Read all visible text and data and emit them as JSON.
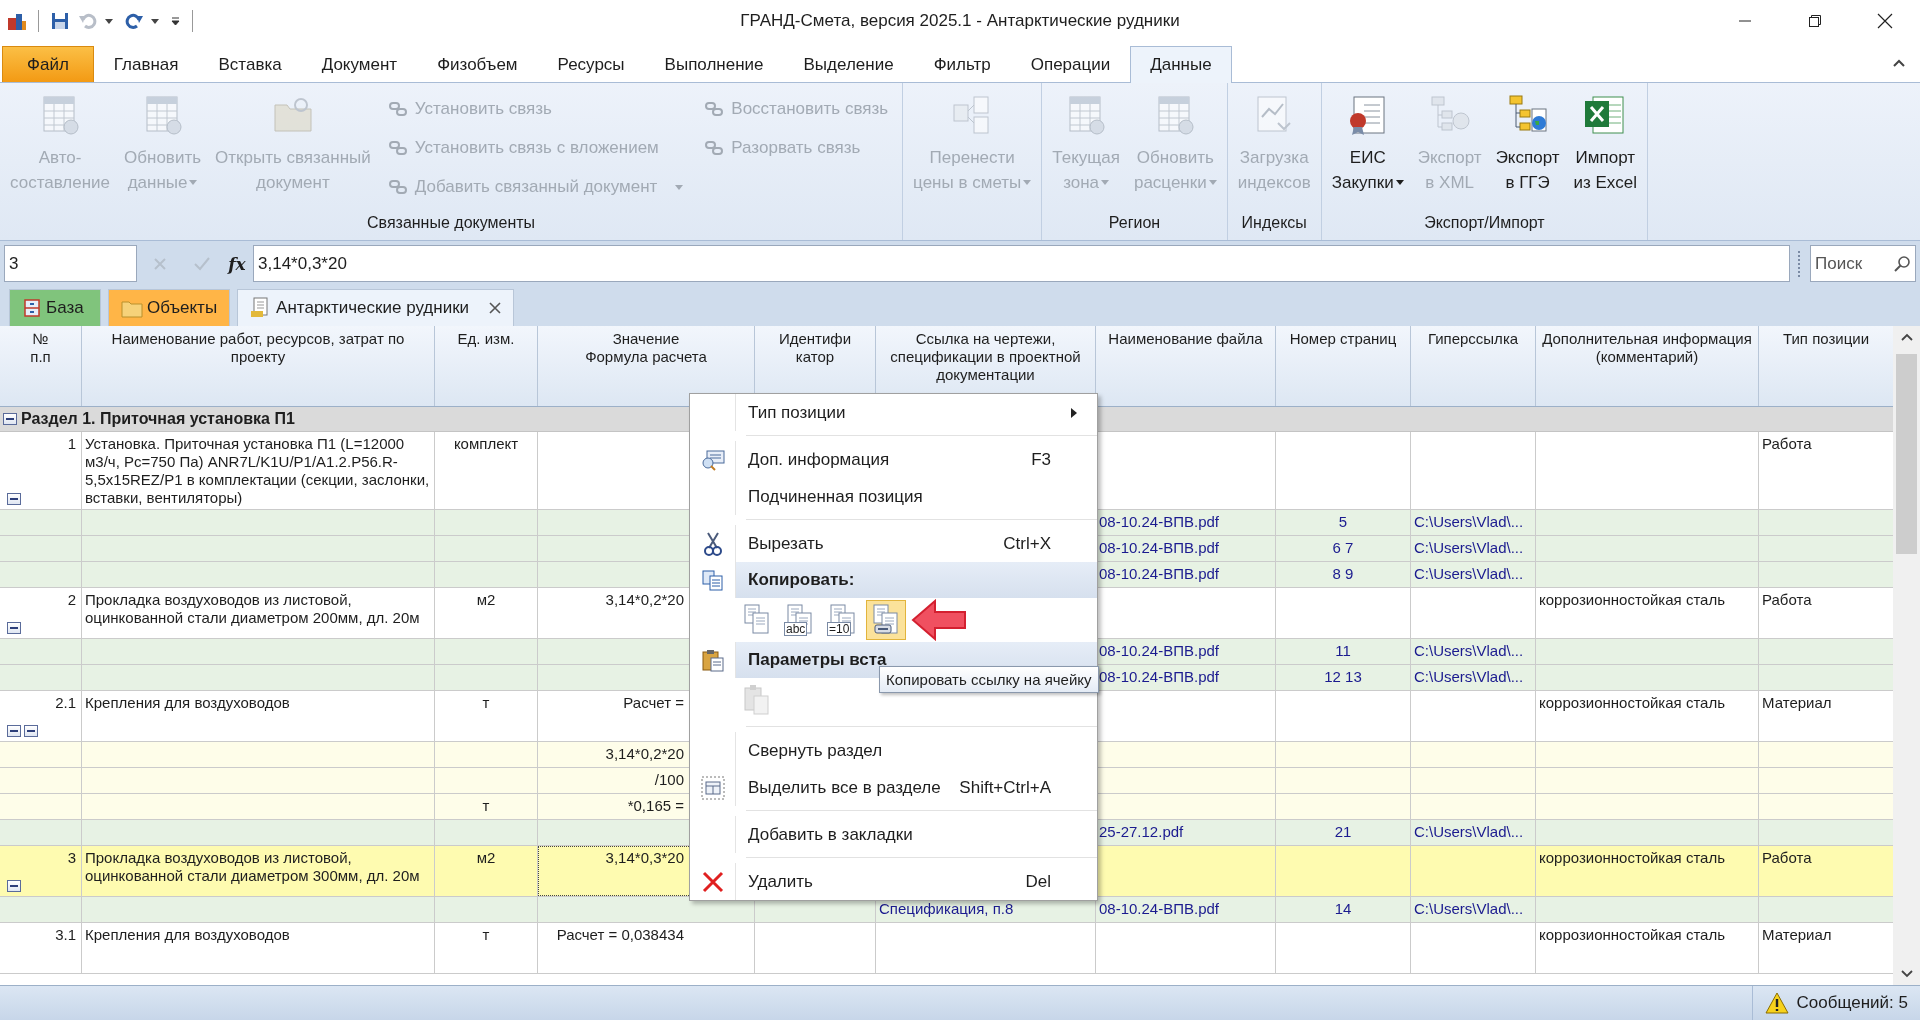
{
  "window": {
    "title": "ГРАНД-Смета, версия 2025.1 - Антарктические рудники"
  },
  "quick_access": [
    {
      "kind": "save",
      "disabled": false,
      "has_menu": false
    },
    {
      "kind": "undo",
      "disabled": true,
      "has_menu": true
    },
    {
      "kind": "redo",
      "disabled": false,
      "has_menu": true
    }
  ],
  "ribbon": {
    "tabs": [
      {
        "label": "Файл",
        "kind": "file",
        "selected": false
      },
      {
        "label": "Главная",
        "kind": "tab",
        "selected": false
      },
      {
        "label": "Вставка",
        "kind": "tab",
        "selected": false
      },
      {
        "label": "Документ",
        "kind": "tab",
        "selected": false
      },
      {
        "label": "Физобъем",
        "kind": "tab",
        "selected": false
      },
      {
        "label": "Ресурсы",
        "kind": "tab",
        "selected": false
      },
      {
        "label": "Выполнение",
        "kind": "tab",
        "selected": false
      },
      {
        "label": "Выделение",
        "kind": "tab",
        "selected": false
      },
      {
        "label": "Фильтр",
        "kind": "tab",
        "selected": false
      },
      {
        "label": "Операции",
        "kind": "tab",
        "selected": false
      },
      {
        "label": "Данные",
        "kind": "tab",
        "selected": true
      }
    ],
    "groups": [
      {
        "label": "Связанные документы",
        "large": [
          {
            "lines": [
              "Авто-",
              "составление"
            ],
            "disabled": true,
            "dropdown": false
          },
          {
            "lines": [
              "Обновить",
              "данные"
            ],
            "disabled": true,
            "dropdown": true
          },
          {
            "lines": [
              "Открыть связанный",
              "документ"
            ],
            "disabled": true,
            "dropdown": false
          }
        ],
        "small_columns": [
          [
            {
              "label": "Установить связь",
              "disabled": true,
              "dropdown": false
            },
            {
              "label": "Установить связь с вложением",
              "disabled": true,
              "dropdown": false
            },
            {
              "label": "Добавить связанный документ",
              "disabled": true,
              "dropdown": true
            }
          ],
          [
            {
              "label": "Восстановить связь",
              "disabled": true,
              "dropdown": false
            },
            {
              "label": "Разорвать связь",
              "disabled": true,
              "dropdown": false
            }
          ]
        ]
      },
      {
        "large": [
          {
            "lines": [
              "Перенести",
              "цены в сметы"
            ],
            "disabled": true,
            "dropdown": true
          }
        ]
      },
      {
        "label": "Регион",
        "large": [
          {
            "lines": [
              "Текущая",
              "зона"
            ],
            "disabled": true,
            "dropdown": true
          },
          {
            "lines": [
              "Обновить",
              "расценки"
            ],
            "disabled": true,
            "dropdown": true
          }
        ]
      },
      {
        "label": "Индексы",
        "large": [
          {
            "lines": [
              "Загрузка",
              "индексов"
            ],
            "disabled": true,
            "dropdown": false
          }
        ]
      },
      {
        "label": "Экспорт/Импорт",
        "large": [
          {
            "lines": [
              "ЕИС",
              "Закупки"
            ],
            "disabled": false,
            "dropdown": true
          },
          {
            "lines": [
              "Экспорт",
              "в XML"
            ],
            "disabled": true,
            "dropdown": false
          },
          {
            "lines": [
              "Экспорт",
              "в ГГЭ"
            ],
            "disabled": false,
            "dropdown": false
          },
          {
            "lines": [
              "Импорт",
              "из Excel"
            ],
            "disabled": false,
            "dropdown": false
          }
        ]
      }
    ]
  },
  "formula_bar": {
    "cell": "3",
    "edit_buttons_disabled": true,
    "function_label": "fx",
    "formula": "3,14*0,3*20",
    "search": {
      "placeholder": "Поиск"
    }
  },
  "doc_tabs": [
    {
      "label": "База",
      "color": "#80c47c",
      "selected": false,
      "closable": false
    },
    {
      "label": "Объекты",
      "color": "#ffb547",
      "selected": false,
      "closable": false
    },
    {
      "label": "Антарктические рудники",
      "selected": true,
      "closable": true
    }
  ],
  "table": {
    "columns": [
      "№\nп.п",
      "Наименование работ, ресурсов, затрат по проекту",
      "Ед. изм.",
      "Значение\nФормула расчета",
      "Идентифи\nкатор",
      "Ссылка на чертежи, спецификации в проектной документации",
      "Наименование файла",
      "Номер страниц",
      "Гиперссылка",
      "Дополнительная информация (комментарий)",
      "Тип позиции"
    ],
    "rows": [
      {
        "kind": "section",
        "title": "Раздел 1. Приточная установка П1",
        "expanded": true
      },
      {
        "kind": "position",
        "selected": false,
        "toggles": [
          {
            "expanded": true
          }
        ],
        "cells": [
          "1",
          "Установка. Приточная установка П1 (L=12000 м3/ч, Рс=750 Па) ANR7L/K1U/P1/A1.2.P56.R-5,5x15REZ/P1 в комплектации (секции, заслонки, вставки, вентиляторы)",
          "комплект",
          null,
          null,
          null,
          null,
          null,
          null,
          null,
          "Работа"
        ]
      },
      {
        "kind": "link",
        "cells": [
          null,
          null,
          null,
          null,
          null,
          null,
          "08-10.24-ВПВ.pdf",
          "5",
          "C:\\Users\\Vlad\\...",
          null,
          null
        ]
      },
      {
        "kind": "link",
        "cells": [
          null,
          null,
          null,
          null,
          null,
          null,
          "08-10.24-ВПВ.pdf",
          "6 7",
          "C:\\Users\\Vlad\\...",
          null,
          null
        ]
      },
      {
        "kind": "link",
        "cells": [
          null,
          null,
          null,
          null,
          null,
          null,
          "08-10.24-ВПВ.pdf",
          "8 9",
          "C:\\Users\\Vlad\\...",
          null,
          null
        ]
      },
      {
        "kind": "position",
        "selected": false,
        "toggles": [
          {
            "expanded": true
          }
        ],
        "cells": [
          "2",
          "Прокладка воздуховодов из листовой, оцинкованной стали диаметром 200мм, дл. 20м",
          "м2",
          "3,14*0,2*20",
          null,
          null,
          null,
          null,
          null,
          "коррозионностойкая сталь",
          "Работа"
        ]
      },
      {
        "kind": "link",
        "cells": [
          null,
          null,
          null,
          null,
          null,
          null,
          "08-10.24-ВПВ.pdf",
          "11",
          "C:\\Users\\Vlad\\...",
          null,
          null
        ]
      },
      {
        "kind": "link",
        "cells": [
          null,
          null,
          null,
          null,
          null,
          null,
          "08-10.24-ВПВ.pdf",
          "12 13",
          "C:\\Users\\Vlad\\...",
          null,
          null
        ]
      },
      {
        "kind": "position",
        "selected": false,
        "toggles": [
          {
            "expanded": true
          },
          {
            "expanded": true
          }
        ],
        "cells": [
          "2.1",
          "Крепления для воздуховодов",
          "т",
          "Расчет =",
          null,
          null,
          null,
          null,
          null,
          "коррозионностойкая сталь",
          "Материал"
        ]
      },
      {
        "kind": "calc",
        "cells": [
          null,
          null,
          null,
          "3,14*0,2*20",
          null,
          null,
          null,
          null,
          null,
          null,
          null
        ]
      },
      {
        "kind": "calc",
        "cells": [
          null,
          null,
          null,
          "/100",
          null,
          null,
          null,
          null,
          null,
          null,
          null
        ]
      },
      {
        "kind": "calc",
        "cells": [
          null,
          null,
          "т",
          "*0,165 =",
          null,
          null,
          null,
          null,
          null,
          null,
          null
        ]
      },
      {
        "kind": "link",
        "cells": [
          null,
          null,
          null,
          null,
          null,
          null,
          "25-27.12.pdf",
          "21",
          "C:\\Users\\Vlad\\...",
          null,
          null
        ]
      },
      {
        "kind": "position",
        "selected": true,
        "toggles": [
          {
            "expanded": true
          }
        ],
        "cells": [
          "3",
          "Прокладка воздуховодов из листовой, оцинкованной стали диаметром 300мм, дл. 20м",
          "м2",
          "3,14*0,3*20",
          null,
          null,
          null,
          null,
          null,
          "коррозионностойкая сталь",
          "Работа"
        ]
      },
      {
        "kind": "link",
        "cells": [
          null,
          null,
          null,
          null,
          null,
          "Спецификация, п.8",
          "08-10.24-ВПВ.pdf",
          "14",
          "C:\\Users\\Vlad\\...",
          null,
          null
        ]
      },
      {
        "kind": "position",
        "selected": false,
        "cells": [
          "3.1",
          "Крепления для воздуховодов",
          "т",
          "Расчет = 0,038434",
          null,
          null,
          null,
          null,
          null,
          "коррозионностойкая сталь",
          "Материал"
        ]
      }
    ]
  },
  "context_menu": {
    "items": [
      {
        "kind": "item",
        "label": "Тип позиции",
        "submenu": true
      },
      {
        "kind": "separator"
      },
      {
        "kind": "item",
        "label": "Доп. информация",
        "shortcut": "F3"
      },
      {
        "kind": "item",
        "label": "Подчиненная позиция"
      },
      {
        "kind": "separator"
      },
      {
        "kind": "item",
        "label": "Вырезать",
        "shortcut": "Ctrl+X"
      },
      {
        "kind": "header",
        "label": "Копировать:"
      },
      {
        "kind": "buttons",
        "buttons": [
          {
            "selected": false,
            "disabled": false
          },
          {
            "caption": "abc",
            "selected": false,
            "disabled": false
          },
          {
            "caption": "=10",
            "selected": false,
            "disabled": false
          },
          {
            "selected": true,
            "disabled": false
          }
        ]
      },
      {
        "kind": "header",
        "label": "Параметры вста"
      },
      {
        "kind": "buttons",
        "buttons": [
          {
            "selected": false,
            "disabled": true
          }
        ]
      },
      {
        "kind": "separator"
      },
      {
        "kind": "item",
        "label": "Свернуть раздел"
      },
      {
        "kind": "item",
        "label": "Выделить все в разделе",
        "shortcut": "Shift+Ctrl+A"
      },
      {
        "kind": "separator"
      },
      {
        "kind": "item",
        "label": "Добавить в закладки"
      },
      {
        "kind": "separator"
      },
      {
        "kind": "item",
        "label": "Удалить",
        "shortcut": "Del"
      }
    ],
    "tooltip": "Копировать ссылку на ячейку"
  },
  "status_bar": {
    "messages": "Сообщений: 5"
  }
}
